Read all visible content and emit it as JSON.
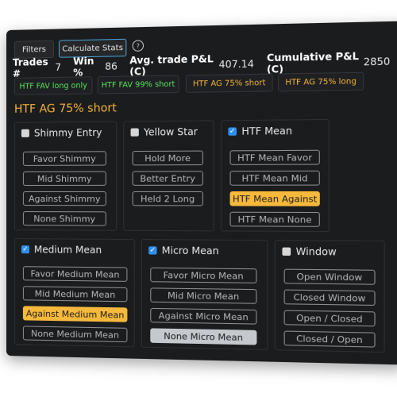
{
  "toolbar": {
    "filters_label": "Filters",
    "calc_label": "Calculate Stats",
    "help_glyph": "?"
  },
  "stats": {
    "trades_label": "Trades #",
    "trades_value": "7",
    "win_label": "Win %",
    "win_value": "86",
    "avg_label": "Avg. trade P&L (C)",
    "avg_value": "407.14",
    "cum_label": "Cumulative P&L (C)",
    "cum_value": "2850"
  },
  "chips": [
    {
      "label": "HTF FAV long only",
      "color": "#56e35a"
    },
    {
      "label": "HTF FAV 99% short",
      "color": "#56e35a"
    },
    {
      "label": "HTF AG 75% short",
      "color": "#f2b33a"
    },
    {
      "label": "HTF AG 75% long",
      "color": "#f2b33a"
    }
  ],
  "selected_title": "HTF AG 75% short",
  "panels": {
    "shimmy": {
      "title": "Shimmy Entry",
      "checked": false,
      "options": [
        "Favor Shimmy",
        "Mid Shimmy",
        "Against Shimmy",
        "None Shimmy"
      ]
    },
    "yellow": {
      "title": "Yellow Star",
      "checked": false,
      "options": [
        "Hold More",
        "Better Entry",
        "Held 2 Long"
      ]
    },
    "htf": {
      "title": "HTF Mean",
      "checked": true,
      "options": [
        "HTF Mean Favor",
        "HTF Mean Mid",
        "HTF Mean Against",
        "HTF Mean None"
      ]
    },
    "medium": {
      "title": "Medium Mean",
      "checked": true,
      "options": [
        "Favor Medium Mean",
        "Mid Medium Mean",
        "Against Medium Mean",
        "None Medium Mean"
      ]
    },
    "micro": {
      "title": "Micro Mean",
      "checked": true,
      "options": [
        "Favor Micro Mean",
        "Mid Micro Mean",
        "Against Micro Mean",
        "None Micro Mean"
      ]
    },
    "window": {
      "title": "Window",
      "checked": false,
      "options": [
        "Open Window",
        "Closed Window",
        "Open / Closed",
        "Closed / Open"
      ]
    }
  },
  "colors": {
    "accent_blue": "#2d8ff0",
    "highlight_orange": "#f6b93b",
    "highlight_gray": "#c5c8cc",
    "green_text": "#56e35a",
    "orange_text": "#f2b33a"
  },
  "check_glyph": "✓"
}
